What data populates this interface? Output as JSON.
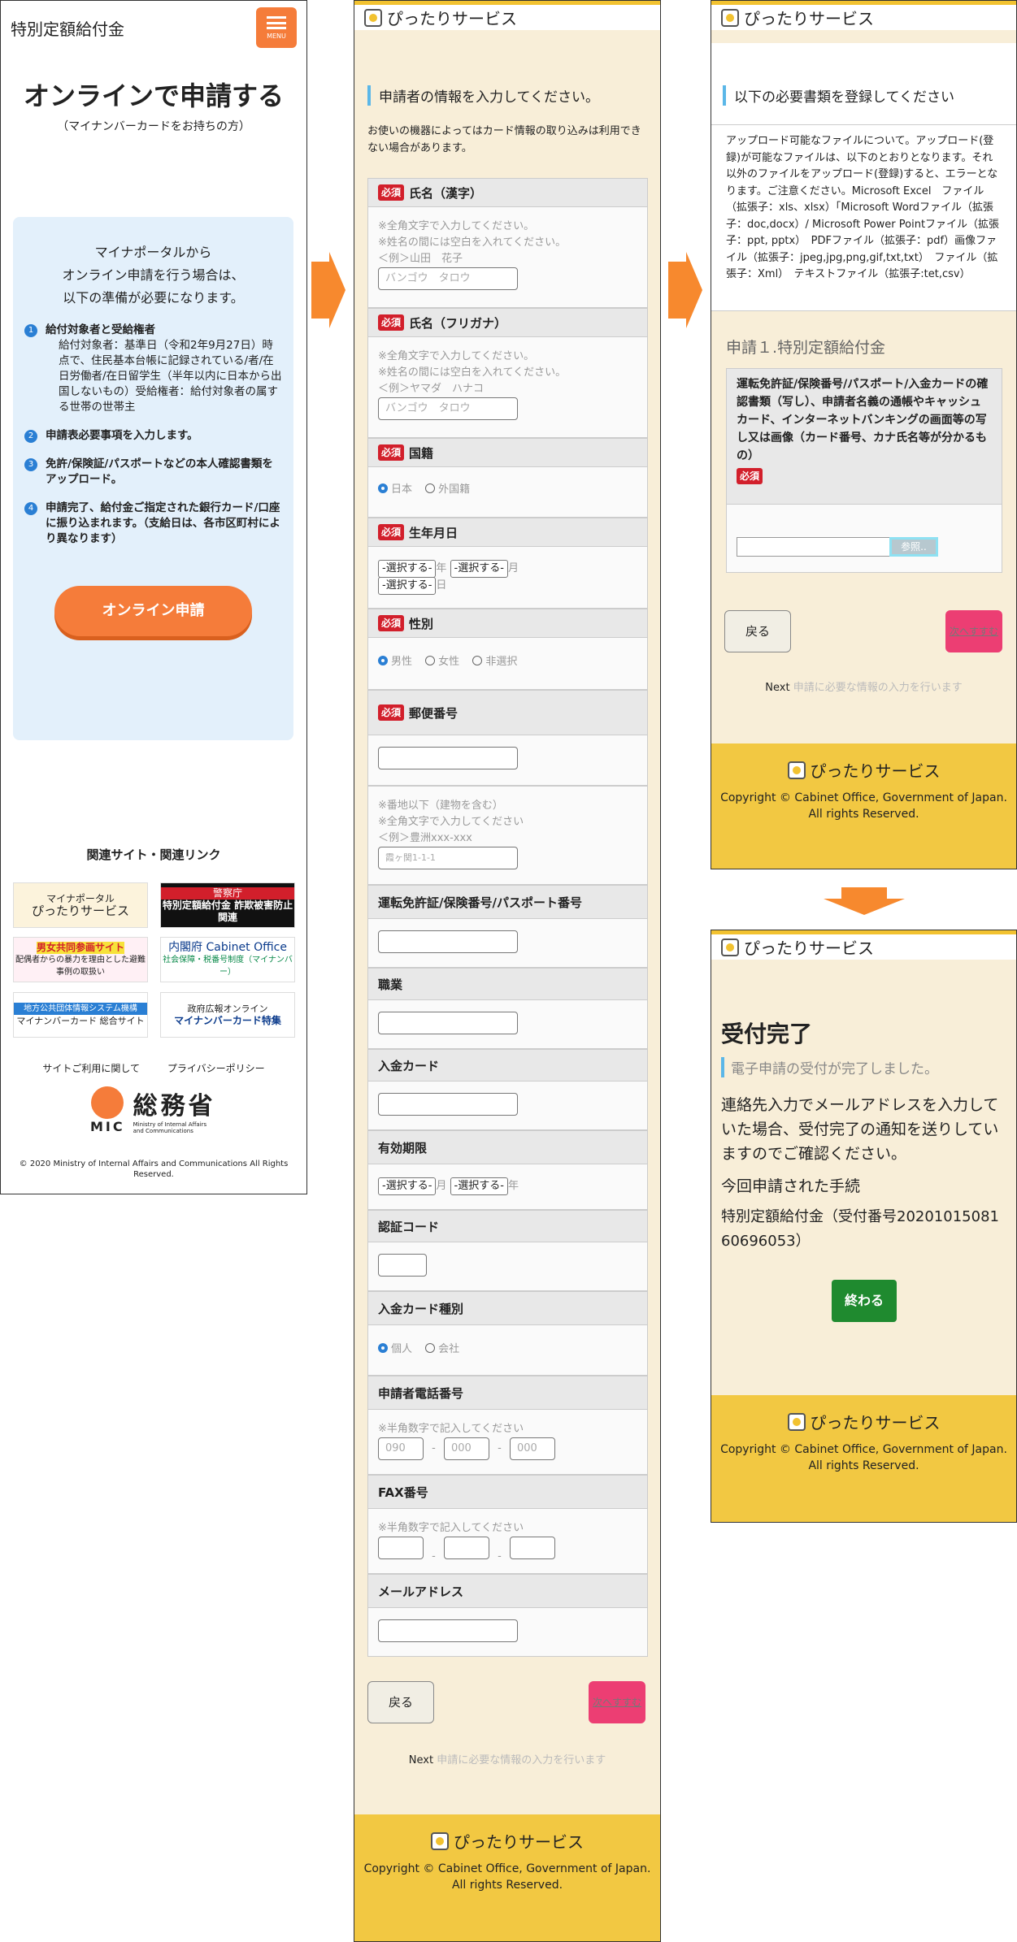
{
  "panel1": {
    "header_title": "特別定額給付金",
    "menu_label": "MENU",
    "main_title": "オンラインで申請する",
    "subtitle": "（マイナンバーカードをお持ちの方）",
    "intro": [
      "マイナポータルから",
      "オンライン申請を行う場合は、",
      "以下の準備が必要になります。"
    ],
    "steps": [
      {
        "num": "1",
        "title": "給付対象者と受給権者",
        "detail": "給付対象者：基準日（令和2年9月27日）時点で、住民基本台帳に記録されている/者/在日労働者/在日留学生（半年以内に日本から出国しないもの）受給権者：給付対象者の属する世帯の世帯主"
      },
      {
        "num": "2",
        "title": "申請表必要事項を入力します。",
        "detail": ""
      },
      {
        "num": "3",
        "title": "免許/保険証/パスポートなどの本人確認書類をアップロード。",
        "detail": ""
      },
      {
        "num": "4",
        "title": "申請完了、給付金ご指定された銀行カード/口座に振り込まれます。（支給日は、各市区町村により異なります）",
        "detail": ""
      }
    ],
    "online_button": "オンライン申請",
    "related_title": "関連サイト・関連リンク",
    "banners": [
      {
        "top": "マイナポータル",
        "main": "ぴったりサービス"
      },
      {
        "top": "警察庁",
        "main": "特別定額給付金 詐欺被害防止関連"
      },
      {
        "top": "男女共同参画サイト",
        "main": "配偶者からの暴力を理由とした避難事例の取扱い"
      },
      {
        "top": "内閣府 Cabinet Office",
        "main": "社会保障・税番号制度（マイナンバー）"
      },
      {
        "top": "地方公共団体情報システム機構",
        "main": "マイナンバーカード 総合サイト"
      },
      {
        "top": "政府広報オンライン",
        "main": "マイナンバーカード特集"
      }
    ],
    "footer_links": [
      "サイトご利用に関して",
      "プライバシーポリシー"
    ],
    "ministry_name": "総務省",
    "ministry_abbr": "MIC",
    "ministry_en": "Ministry of Internal Affairs and Communications",
    "copyright": "© 2020 Ministry of Internal Affairs and Communications All Rights Reserved."
  },
  "service_name": "ぴったりサービス",
  "service_copyright": "Copyright © Cabinet Office, Government of Japan. All rights Reserved.",
  "panel2": {
    "section_title": "申請者の情報を入力してください。",
    "note": "お使いの機器によってはカード情報の取り込みは利用できない場合があります。",
    "required": "必須",
    "name_kanji": {
      "label": "氏名（漢字）",
      "hint1": "※全角文字で入力してください。",
      "hint2": "※姓名の間には空白を入れてください。",
      "example": "＜例＞山田　花子",
      "placeholder": "バンゴウ　タロウ"
    },
    "name_kana": {
      "label": "氏名（フリガナ）",
      "hint1": "※全角文字で入力してください。",
      "hint2": "※姓名の間には空白を入れてください。",
      "example": "＜例＞ヤマダ　ハナコ",
      "placeholder": "バンゴウ　タロウ"
    },
    "nationality": {
      "label": "国籍",
      "options": [
        "日本",
        "外国籍"
      ]
    },
    "birthdate": {
      "label": "生年月日",
      "select": "-選択する-",
      "year": "年",
      "month": "月",
      "day": "日"
    },
    "gender": {
      "label": "性別",
      "options": [
        "男性",
        "女性",
        "非選択"
      ]
    },
    "postal": {
      "label": "郵便番号",
      "hint1": "※番地以下（建物を含む）",
      "hint2": "※全角文字で入力してください",
      "example": "＜例＞豊洲xxx-xxx",
      "placeholder": "霞ヶ関1-1-1"
    },
    "license": {
      "label": "運転免許証/保険番号/パスポート番号"
    },
    "occupation": {
      "label": "職業"
    },
    "card": {
      "label": "入金カード"
    },
    "expiry": {
      "label": "有効期限",
      "select": "-選択する-",
      "month": "月",
      "year": "年"
    },
    "auth_code": {
      "label": "認証コード"
    },
    "card_type": {
      "label": "入金カード種別",
      "options": [
        "個人",
        "会社"
      ]
    },
    "phone": {
      "label": "申請者電話番号",
      "hint": "※半角数字で記入してください",
      "p1": "090",
      "p2": "000",
      "p3": "000",
      "dash": "-"
    },
    "fax": {
      "label": "FAX番号",
      "hint": "※半角数字で記入してください"
    },
    "email": {
      "label": "メールアドレス"
    },
    "back": "戻る",
    "next": "次へすすむ",
    "next_note_strong": "Next",
    "next_note": "申請に必要な情報の入力を行います"
  },
  "panel3": {
    "section_title": "以下の必要書類を登録してください",
    "info": "アップロード可能なファイルについて。アップロード(登録)が可能なファイルは、以下のとおりとなります。それ以外のファイルをアップロード(登録)すると、エラーとなります。ご注意ください。Microsoft Excel　ファイル（拡張子：xls、xlsx）「Microsoft Wordファイル（拡張子：doc,docx）/ Microsoft Power Pointファイル（拡張子：ppt, pptx）　PDFファイル（拡張子：pdf）画像ファイル（拡張子：jpeg,jpg,png,gif,txt,txt）　ファイル（拡張子：Xml）　テキストファイル（拡張子:tet,csv）",
    "apply_title": "申請１.特別定額給付金",
    "doc_desc": "運転免許証/保険番号/パスポート/入金カードの確認書類（写し）、申請者名義の通帳やキャッシュカード、インターネットバンキングの画面等の写し又は画像（カード番号、カナ氏名等が分かるもの）",
    "required": "必須",
    "browse": "参照..",
    "back": "戻る",
    "next": "次へすすむ",
    "next_note_strong": "Next",
    "next_note": "申請に必要な情報の入力を行います"
  },
  "panel4": {
    "title": "受付完了",
    "subtitle": "電子申請の受付が完了しました。",
    "message": "連絡先入力でメールアドレスを入力していた場合、受付完了の通知を送りしていますのでご確認ください。",
    "proc_label": "今回申請された手続",
    "proc_value": "特別定額給付金（受付番号2020101508160696053）",
    "finish": "終わる"
  }
}
